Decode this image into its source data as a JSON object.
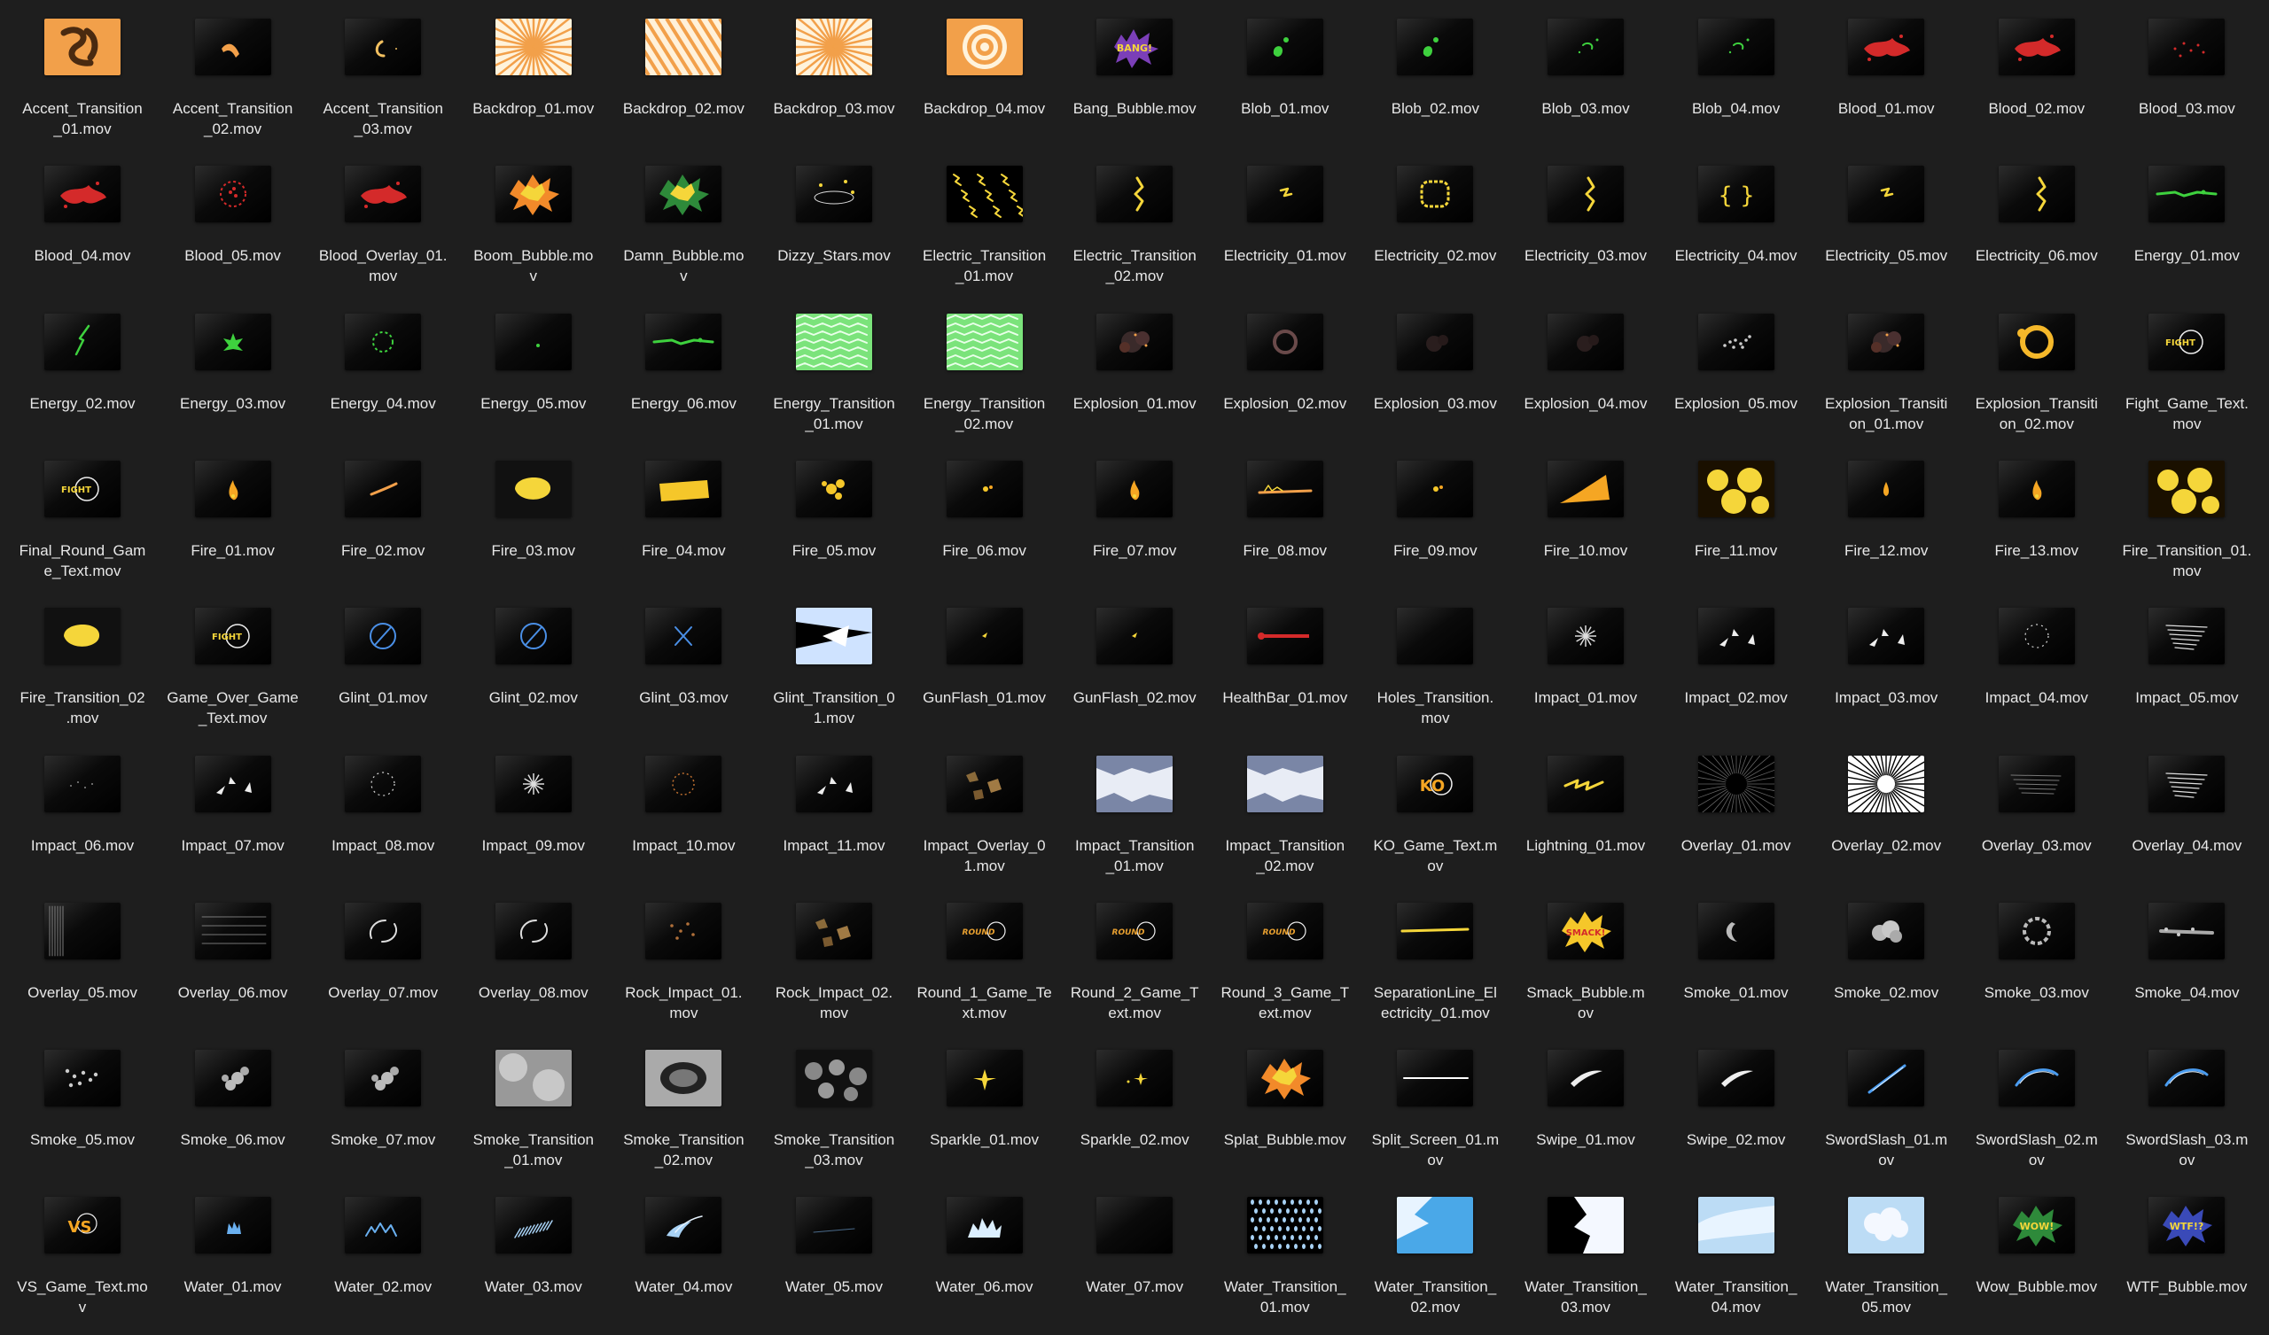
{
  "files": [
    {
      "name": "Accent_Transition_01.mov",
      "label_lines": [
        "Accent_Transition",
        "_01.mov"
      ],
      "thumb": "accent-1"
    },
    {
      "name": "Accent_Transition_02.mov",
      "label_lines": [
        "Accent_Transition",
        "_02.mov"
      ],
      "thumb": "accent-2"
    },
    {
      "name": "Accent_Transition_03.mov",
      "label_lines": [
        "Accent_Transition",
        "_03.mov"
      ],
      "thumb": "accent-3"
    },
    {
      "name": "Backdrop_01.mov",
      "label_lines": [
        "Backdrop_01.mov"
      ],
      "thumb": "rays"
    },
    {
      "name": "Backdrop_02.mov",
      "label_lines": [
        "Backdrop_02.mov"
      ],
      "thumb": "stripes"
    },
    {
      "name": "Backdrop_03.mov",
      "label_lines": [
        "Backdrop_03.mov"
      ],
      "thumb": "rays"
    },
    {
      "name": "Backdrop_04.mov",
      "label_lines": [
        "Backdrop_04.mov"
      ],
      "thumb": "rings"
    },
    {
      "name": "Bang_Bubble.mov",
      "label_lines": [
        "Bang_Bubble.mov"
      ],
      "thumb": "bubble-purple"
    },
    {
      "name": "Blob_01.mov",
      "label_lines": [
        "Blob_01.mov"
      ],
      "thumb": "blob-green"
    },
    {
      "name": "Blob_02.mov",
      "label_lines": [
        "Blob_02.mov"
      ],
      "thumb": "blob-green"
    },
    {
      "name": "Blob_03.mov",
      "label_lines": [
        "Blob_03.mov"
      ],
      "thumb": "blob-green-small"
    },
    {
      "name": "Blob_04.mov",
      "label_lines": [
        "Blob_04.mov"
      ],
      "thumb": "blob-green-small"
    },
    {
      "name": "Blood_01.mov",
      "label_lines": [
        "Blood_01.mov"
      ],
      "thumb": "blood"
    },
    {
      "name": "Blood_02.mov",
      "label_lines": [
        "Blood_02.mov"
      ],
      "thumb": "blood"
    },
    {
      "name": "Blood_03.mov",
      "label_lines": [
        "Blood_03.mov"
      ],
      "thumb": "blood-dots"
    },
    {
      "name": "Blood_04.mov",
      "label_lines": [
        "Blood_04.mov"
      ],
      "thumb": "blood"
    },
    {
      "name": "Blood_05.mov",
      "label_lines": [
        "Blood_05.mov"
      ],
      "thumb": "blood-ring"
    },
    {
      "name": "Blood_Overlay_01.mov",
      "label_lines": [
        "Blood_Overlay_01.",
        "mov"
      ],
      "thumb": "blood"
    },
    {
      "name": "Boom_Bubble.mov",
      "label_lines": [
        "Boom_Bubble.mo",
        "v"
      ],
      "thumb": "bubble-orange"
    },
    {
      "name": "Damn_Bubble.mov",
      "label_lines": [
        "Damn_Bubble.mo",
        "v"
      ],
      "thumb": "bubble-green"
    },
    {
      "name": "Dizzy_Stars.mov",
      "label_lines": [
        "Dizzy_Stars.mov"
      ],
      "thumb": "stars-ring"
    },
    {
      "name": "Electric_Transition_01.mov",
      "label_lines": [
        "Electric_Transition",
        "_01.mov"
      ],
      "thumb": "electric-full"
    },
    {
      "name": "Electric_Transition_02.mov",
      "label_lines": [
        "Electric_Transition",
        "_02.mov"
      ],
      "thumb": "bolt"
    },
    {
      "name": "Electricity_01.mov",
      "label_lines": [
        "Electricity_01.mov"
      ],
      "thumb": "bolt-small"
    },
    {
      "name": "Electricity_02.mov",
      "label_lines": [
        "Electricity_02.mov"
      ],
      "thumb": "electric-ring"
    },
    {
      "name": "Electricity_03.mov",
      "label_lines": [
        "Electricity_03.mov"
      ],
      "thumb": "bolt"
    },
    {
      "name": "Electricity_04.mov",
      "label_lines": [
        "Electricity_04.mov"
      ],
      "thumb": "brackets"
    },
    {
      "name": "Electricity_05.mov",
      "label_lines": [
        "Electricity_05.mov"
      ],
      "thumb": "bolt-small"
    },
    {
      "name": "Electricity_06.mov",
      "label_lines": [
        "Electricity_06.mov"
      ],
      "thumb": "bolt"
    },
    {
      "name": "Energy_01.mov",
      "label_lines": [
        "Energy_01.mov"
      ],
      "thumb": "energy-line"
    },
    {
      "name": "Energy_02.mov",
      "label_lines": [
        "Energy_02.mov"
      ],
      "thumb": "energy-bolt"
    },
    {
      "name": "Energy_03.mov",
      "label_lines": [
        "Energy_03.mov"
      ],
      "thumb": "energy-burst"
    },
    {
      "name": "Energy_04.mov",
      "label_lines": [
        "Energy_04.mov"
      ],
      "thumb": "energy-ring"
    },
    {
      "name": "Energy_05.mov",
      "label_lines": [
        "Energy_05.mov"
      ],
      "thumb": "energy-dot"
    },
    {
      "name": "Energy_06.mov",
      "label_lines": [
        "Energy_06.mov"
      ],
      "thumb": "energy-line"
    },
    {
      "name": "Energy_Transition_01.mov",
      "label_lines": [
        "Energy_Transition",
        "_01.mov"
      ],
      "thumb": "energy-full"
    },
    {
      "name": "Energy_Transition_02.mov",
      "label_lines": [
        "Energy_Transition",
        "_02.mov"
      ],
      "thumb": "energy-full"
    },
    {
      "name": "Explosion_01.mov",
      "label_lines": [
        "Explosion_01.mov"
      ],
      "thumb": "explosion-dark"
    },
    {
      "name": "Explosion_02.mov",
      "label_lines": [
        "Explosion_02.mov"
      ],
      "thumb": "explosion-ring"
    },
    {
      "name": "Explosion_03.mov",
      "label_lines": [
        "Explosion_03.mov"
      ],
      "thumb": "explosion-faint"
    },
    {
      "name": "Explosion_04.mov",
      "label_lines": [
        "Explosion_04.mov"
      ],
      "thumb": "explosion-faint"
    },
    {
      "name": "Explosion_05.mov",
      "label_lines": [
        "Explosion_05.mov"
      ],
      "thumb": "explosion-white"
    },
    {
      "name": "Explosion_Transition_01.mov",
      "label_lines": [
        "Explosion_Transiti",
        "on_01.mov"
      ],
      "thumb": "explosion-dark"
    },
    {
      "name": "Explosion_Transition_02.mov",
      "label_lines": [
        "Explosion_Transiti",
        "on_02.mov"
      ],
      "thumb": "fire-ring"
    },
    {
      "name": "Fight_Game_Text.mov",
      "label_lines": [
        "Fight_Game_Text.",
        "mov"
      ],
      "thumb": "game-text"
    },
    {
      "name": "Final_Round_Game_Text.mov",
      "label_lines": [
        "Final_Round_Gam",
        "e_Text.mov"
      ],
      "thumb": "game-text"
    },
    {
      "name": "Fire_01.mov",
      "label_lines": [
        "Fire_01.mov"
      ],
      "thumb": "flame"
    },
    {
      "name": "Fire_02.mov",
      "label_lines": [
        "Fire_02.mov"
      ],
      "thumb": "flame-streak"
    },
    {
      "name": "Fire_03.mov",
      "label_lines": [
        "Fire_03.mov"
      ],
      "thumb": "fire-ball"
    },
    {
      "name": "Fire_04.mov",
      "label_lines": [
        "Fire_04.mov"
      ],
      "thumb": "fire-blob"
    },
    {
      "name": "Fire_05.mov",
      "label_lines": [
        "Fire_05.mov"
      ],
      "thumb": "fire-burst"
    },
    {
      "name": "Fire_06.mov",
      "label_lines": [
        "Fire_06.mov"
      ],
      "thumb": "flame-small"
    },
    {
      "name": "Fire_07.mov",
      "label_lines": [
        "Fire_07.mov"
      ],
      "thumb": "flame"
    },
    {
      "name": "Fire_08.mov",
      "label_lines": [
        "Fire_08.mov"
      ],
      "thumb": "flame-line"
    },
    {
      "name": "Fire_09.mov",
      "label_lines": [
        "Fire_09.mov"
      ],
      "thumb": "flame-small"
    },
    {
      "name": "Fire_10.mov",
      "label_lines": [
        "Fire_10.mov"
      ],
      "thumb": "fire-wave"
    },
    {
      "name": "Fire_11.mov",
      "label_lines": [
        "Fire_11.mov"
      ],
      "thumb": "fire-full"
    },
    {
      "name": "Fire_12.mov",
      "label_lines": [
        "Fire_12.mov"
      ],
      "thumb": "flame-drop"
    },
    {
      "name": "Fire_13.mov",
      "label_lines": [
        "Fire_13.mov"
      ],
      "thumb": "flame"
    },
    {
      "name": "Fire_Transition_01.mov",
      "label_lines": [
        "Fire_Transition_01.",
        "mov"
      ],
      "thumb": "fire-full"
    },
    {
      "name": "Fire_Transition_02.mov",
      "label_lines": [
        "Fire_Transition_02",
        ".mov"
      ],
      "thumb": "fire-ball"
    },
    {
      "name": "Game_Over_Game_Text.mov",
      "label_lines": [
        "Game_Over_Game",
        "_Text.mov"
      ],
      "thumb": "game-text"
    },
    {
      "name": "Glint_01.mov",
      "label_lines": [
        "Glint_01.mov"
      ],
      "thumb": "glint-circle"
    },
    {
      "name": "Glint_02.mov",
      "label_lines": [
        "Glint_02.mov"
      ],
      "thumb": "glint-circle"
    },
    {
      "name": "Glint_03.mov",
      "label_lines": [
        "Glint_03.mov"
      ],
      "thumb": "glint-x"
    },
    {
      "name": "Glint_Transition_01.mov",
      "label_lines": [
        "Glint_Transition_0",
        "1.mov"
      ],
      "thumb": "glint-full"
    },
    {
      "name": "GunFlash_01.mov",
      "label_lines": [
        "GunFlash_01.mov"
      ],
      "thumb": "flash"
    },
    {
      "name": "GunFlash_02.mov",
      "label_lines": [
        "GunFlash_02.mov"
      ],
      "thumb": "flash"
    },
    {
      "name": "HealthBar_01.mov",
      "label_lines": [
        "HealthBar_01.mov"
      ],
      "thumb": "healthbar"
    },
    {
      "name": "Holes_Transition.mov",
      "label_lines": [
        "Holes_Transition.",
        "mov"
      ],
      "thumb": "empty"
    },
    {
      "name": "Impact_01.mov",
      "label_lines": [
        "Impact_01.mov"
      ],
      "thumb": "impact-burst"
    },
    {
      "name": "Impact_02.mov",
      "label_lines": [
        "Impact_02.mov"
      ],
      "thumb": "impact-spikes"
    },
    {
      "name": "Impact_03.mov",
      "label_lines": [
        "Impact_03.mov"
      ],
      "thumb": "impact-spikes"
    },
    {
      "name": "Impact_04.mov",
      "label_lines": [
        "Impact_04.mov"
      ],
      "thumb": "impact-ring"
    },
    {
      "name": "Impact_05.mov",
      "label_lines": [
        "Impact_05.mov"
      ],
      "thumb": "speed-lines"
    },
    {
      "name": "Impact_06.mov",
      "label_lines": [
        "Impact_06.mov"
      ],
      "thumb": "impact-faint"
    },
    {
      "name": "Impact_07.mov",
      "label_lines": [
        "Impact_07.mov"
      ],
      "thumb": "impact-spikes"
    },
    {
      "name": "Impact_08.mov",
      "label_lines": [
        "Impact_08.mov"
      ],
      "thumb": "impact-ring"
    },
    {
      "name": "Impact_09.mov",
      "label_lines": [
        "Impact_09.mov"
      ],
      "thumb": "impact-burst"
    },
    {
      "name": "Impact_10.mov",
      "label_lines": [
        "Impact_10.mov"
      ],
      "thumb": "impact-orange-ring"
    },
    {
      "name": "Impact_11.mov",
      "label_lines": [
        "Impact_11.mov"
      ],
      "thumb": "impact-spikes"
    },
    {
      "name": "Impact_Overlay_01.mov",
      "label_lines": [
        "Impact_Overlay_0",
        "1.mov"
      ],
      "thumb": "rocks"
    },
    {
      "name": "Impact_Transition_01.mov",
      "label_lines": [
        "Impact_Transition",
        "_01.mov"
      ],
      "thumb": "impact-full"
    },
    {
      "name": "Impact_Transition_02.mov",
      "label_lines": [
        "Impact_Transition",
        "_02.mov"
      ],
      "thumb": "impact-full"
    },
    {
      "name": "KO_Game_Text.mov",
      "label_lines": [
        "KO_Game_Text.m",
        "ov"
      ],
      "thumb": "ko-text"
    },
    {
      "name": "Lightning_01.mov",
      "label_lines": [
        "Lightning_01.mov"
      ],
      "thumb": "lightning"
    },
    {
      "name": "Overlay_01.mov",
      "label_lines": [
        "Overlay_01.mov"
      ],
      "thumb": "radial-lines-dark"
    },
    {
      "name": "Overlay_02.mov",
      "label_lines": [
        "Overlay_02.mov"
      ],
      "thumb": "radial-lines"
    },
    {
      "name": "Overlay_03.mov",
      "label_lines": [
        "Overlay_03.mov"
      ],
      "thumb": "speed-lines-faint"
    },
    {
      "name": "Overlay_04.mov",
      "label_lines": [
        "Overlay_04.mov"
      ],
      "thumb": "speed-lines"
    },
    {
      "name": "Overlay_05.mov",
      "label_lines": [
        "Overlay_05.mov"
      ],
      "thumb": "vertical-lines"
    },
    {
      "name": "Overlay_06.mov",
      "label_lines": [
        "Overlay_06.mov"
      ],
      "thumb": "horizontal-lines"
    },
    {
      "name": "Overlay_07.mov",
      "label_lines": [
        "Overlay_07.mov"
      ],
      "thumb": "swirl"
    },
    {
      "name": "Overlay_08.mov",
      "label_lines": [
        "Overlay_08.mov"
      ],
      "thumb": "swirl"
    },
    {
      "name": "Rock_Impact_01.mov",
      "label_lines": [
        "Rock_Impact_01.",
        "mov"
      ],
      "thumb": "rock-dots"
    },
    {
      "name": "Rock_Impact_02.mov",
      "label_lines": [
        "Rock_Impact_02.",
        "mov"
      ],
      "thumb": "rocks"
    },
    {
      "name": "Round_1_Game_Text.mov",
      "label_lines": [
        "Round_1_Game_Te",
        "xt.mov"
      ],
      "thumb": "round-text"
    },
    {
      "name": "Round_2_Game_Text.mov",
      "label_lines": [
        "Round_2_Game_T",
        "ext.mov"
      ],
      "thumb": "round-text"
    },
    {
      "name": "Round_3_Game_Text.mov",
      "label_lines": [
        "Round_3_Game_T",
        "ext.mov"
      ],
      "thumb": "round-text"
    },
    {
      "name": "SeparationLine_Electricity_01.mov",
      "label_lines": [
        "SeparationLine_El",
        "ectricity_01.mov"
      ],
      "thumb": "yellow-line"
    },
    {
      "name": "Smack_Bubble.mov",
      "label_lines": [
        "Smack_Bubble.m",
        "ov"
      ],
      "thumb": "bubble-yellow"
    },
    {
      "name": "Smoke_01.mov",
      "label_lines": [
        "Smoke_01.mov"
      ],
      "thumb": "smoke-crescent"
    },
    {
      "name": "Smoke_02.mov",
      "label_lines": [
        "Smoke_02.mov"
      ],
      "thumb": "smoke-cloud"
    },
    {
      "name": "Smoke_03.mov",
      "label_lines": [
        "Smoke_03.mov"
      ],
      "thumb": "smoke-ring"
    },
    {
      "name": "Smoke_04.mov",
      "label_lines": [
        "Smoke_04.mov"
      ],
      "thumb": "smoke-line"
    },
    {
      "name": "Smoke_05.mov",
      "label_lines": [
        "Smoke_05.mov"
      ],
      "thumb": "smoke-dots"
    },
    {
      "name": "Smoke_06.mov",
      "label_lines": [
        "Smoke_06.mov"
      ],
      "thumb": "smoke-puffs"
    },
    {
      "name": "Smoke_07.mov",
      "label_lines": [
        "Smoke_07.mov"
      ],
      "thumb": "smoke-puffs"
    },
    {
      "name": "Smoke_Transition_01.mov",
      "label_lines": [
        "Smoke_Transition",
        "_01.mov"
      ],
      "thumb": "smoke-full"
    },
    {
      "name": "Smoke_Transition_02.mov",
      "label_lines": [
        "Smoke_Transition",
        "_02.mov"
      ],
      "thumb": "smoke-frame"
    },
    {
      "name": "Smoke_Transition_03.mov",
      "label_lines": [
        "Smoke_Transition",
        "_03.mov"
      ],
      "thumb": "smoke-grey-puffs"
    },
    {
      "name": "Sparkle_01.mov",
      "label_lines": [
        "Sparkle_01.mov"
      ],
      "thumb": "sparkle"
    },
    {
      "name": "Sparkle_02.mov",
      "label_lines": [
        "Sparkle_02.mov"
      ],
      "thumb": "sparkle-small"
    },
    {
      "name": "Splat_Bubble.mov",
      "label_lines": [
        "Splat_Bubble.mov"
      ],
      "thumb": "bubble-orange"
    },
    {
      "name": "Split_Screen_01.mov",
      "label_lines": [
        "Split_Screen_01.m",
        "ov"
      ],
      "thumb": "white-line"
    },
    {
      "name": "Swipe_01.mov",
      "label_lines": [
        "Swipe_01.mov"
      ],
      "thumb": "swipe"
    },
    {
      "name": "Swipe_02.mov",
      "label_lines": [
        "Swipe_02.mov"
      ],
      "thumb": "swipe"
    },
    {
      "name": "SwordSlash_01.mov",
      "label_lines": [
        "SwordSlash_01.m",
        "ov"
      ],
      "thumb": "slash-diag"
    },
    {
      "name": "SwordSlash_02.mov",
      "label_lines": [
        "SwordSlash_02.m",
        "ov"
      ],
      "thumb": "slash-arc"
    },
    {
      "name": "SwordSlash_03.mov",
      "label_lines": [
        "SwordSlash_03.m",
        "ov"
      ],
      "thumb": "slash-arc"
    },
    {
      "name": "VS_Game_Text.mov",
      "label_lines": [
        "VS_Game_Text.mo",
        "v"
      ],
      "thumb": "vs-text"
    },
    {
      "name": "Water_01.mov",
      "label_lines": [
        "Water_01.mov"
      ],
      "thumb": "water-splash"
    },
    {
      "name": "Water_02.mov",
      "label_lines": [
        "Water_02.mov"
      ],
      "thumb": "water-crown"
    },
    {
      "name": "Water_03.mov",
      "label_lines": [
        "Water_03.mov"
      ],
      "thumb": "water-spray"
    },
    {
      "name": "Water_04.mov",
      "label_lines": [
        "Water_04.mov"
      ],
      "thumb": "water-wave"
    },
    {
      "name": "Water_05.mov",
      "label_lines": [
        "Water_05.mov"
      ],
      "thumb": "water-faint"
    },
    {
      "name": "Water_06.mov",
      "label_lines": [
        "Water_06.mov"
      ],
      "thumb": "water-burst"
    },
    {
      "name": "Water_07.mov",
      "label_lines": [
        "Water_07.mov"
      ],
      "thumb": "empty"
    },
    {
      "name": "Water_Transition_01.mov",
      "label_lines": [
        "Water_Transition_",
        "01.mov"
      ],
      "thumb": "water-drops"
    },
    {
      "name": "Water_Transition_02.mov",
      "label_lines": [
        "Water_Transition_",
        "02.mov"
      ],
      "thumb": "water-full"
    },
    {
      "name": "Water_Transition_03.mov",
      "label_lines": [
        "Water_Transition_",
        "03.mov"
      ],
      "thumb": "water-white"
    },
    {
      "name": "Water_Transition_04.mov",
      "label_lines": [
        "Water_Transition_",
        "04.mov"
      ],
      "thumb": "water-sky"
    },
    {
      "name": "Water_Transition_05.mov",
      "label_lines": [
        "Water_Transition_",
        "05.mov"
      ],
      "thumb": "water-cloud"
    },
    {
      "name": "Wow_Bubble.mov",
      "label_lines": [
        "Wow_Bubble.mov"
      ],
      "thumb": "bubble-green-yellow"
    },
    {
      "name": "WTF_Bubble.mov",
      "label_lines": [
        "WTF_Bubble.mov"
      ],
      "thumb": "bubble-blue"
    }
  ],
  "colors": {
    "background": "#1e1e1e",
    "text": "#e8e8e8",
    "orange": "#f2a04a",
    "yellow": "#f5d63a",
    "green": "#3ed13e",
    "red": "#d42a2a",
    "blue": "#4a8fe6",
    "grey": "#bdbdbd"
  }
}
